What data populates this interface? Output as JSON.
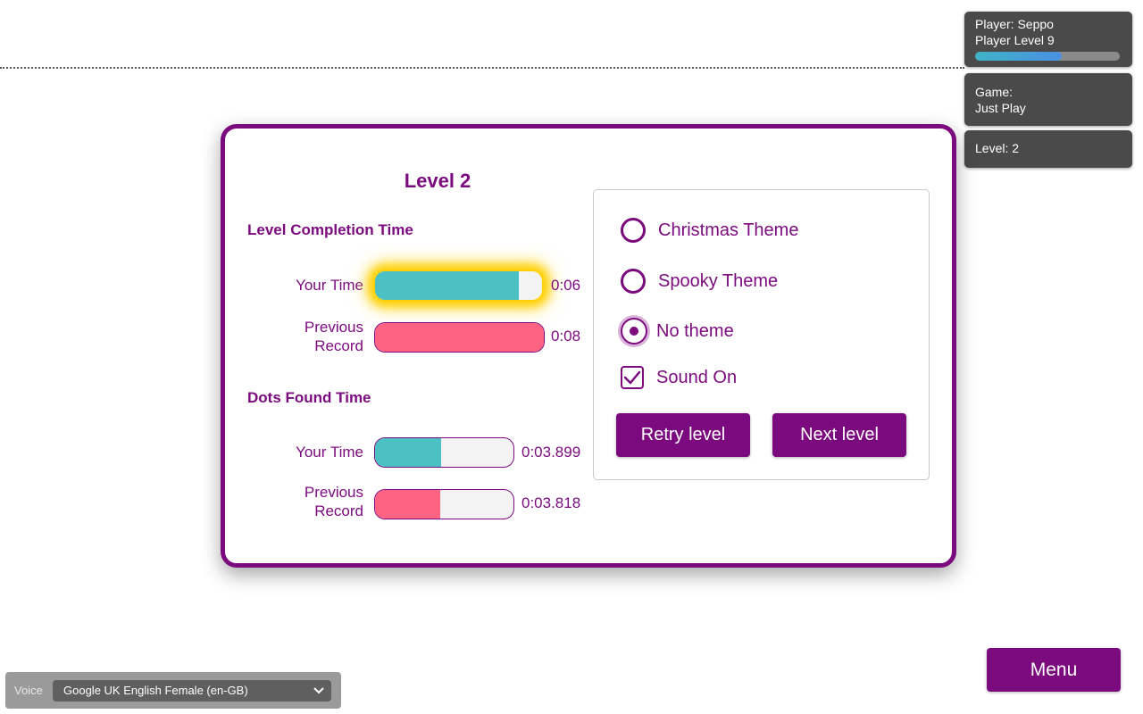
{
  "player": {
    "name_line": "Player: Seppo",
    "level_line": "Player Level 9",
    "xp_progress": 0.6
  },
  "game": {
    "label": "Game:",
    "mode": "Just Play"
  },
  "level_box": "Level: 2",
  "card": {
    "title": "Level 2",
    "completion": {
      "heading": "Level Completion Time",
      "your_time": {
        "label": "Your Time",
        "value": "0:06",
        "fill": 0.86
      },
      "previous_record": {
        "label_line1": "Previous",
        "label_line2": "Record",
        "value": "0:08",
        "fill": 1.0
      }
    },
    "dots": {
      "heading": "Dots Found Time",
      "your_time": {
        "label": "Your Time",
        "value": "0:03.899",
        "fill": 0.48
      },
      "previous_record": {
        "label_line1": "Previous",
        "label_line2": "Record",
        "value": "0:03.818",
        "fill": 0.47
      }
    }
  },
  "options": {
    "christmas": "Christmas Theme",
    "spooky": "Spooky Theme",
    "none": "No theme",
    "sound": "Sound On",
    "retry": "Retry level",
    "next": "Next level"
  },
  "menu": "Menu",
  "voice": {
    "label": "Voice",
    "selected": "Google UK English Female (en-GB)"
  },
  "colors": {
    "accent": "#7b0a7e",
    "teal": "#4cc1c3",
    "pink": "#ff6384",
    "highlight": "#ffd000"
  }
}
